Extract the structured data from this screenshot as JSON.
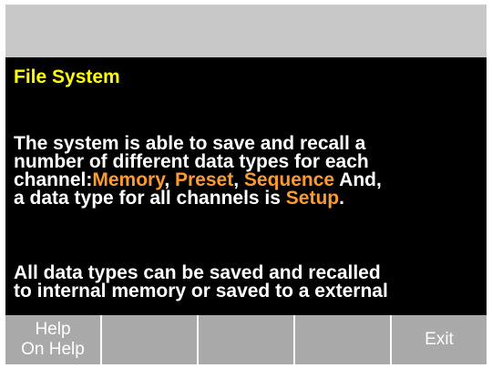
{
  "title": "File System",
  "paragraph1": {
    "lead": "The system is able to save and recall a\nnumber of different data types for each\nchannel:",
    "term_memory": "Memory",
    "sep1": ", ",
    "term_preset": "Preset",
    "sep2": ", ",
    "term_sequence": "Sequence",
    "mid": " And,\na data type for all channels is ",
    "term_setup": "Setup",
    "end": "."
  },
  "paragraph2": "All data types can be saved and recalled\nto internal memory or saved to a external",
  "softkeys": {
    "help_line1": "Help",
    "help_line2": "On Help",
    "key2": "",
    "key3": "",
    "key4": "",
    "exit": "Exit"
  },
  "colors": {
    "panel_background": "#000000",
    "title": "#ffff00",
    "body_text": "#ffffff",
    "highlight_term": "#ff9a2e",
    "top_bar": "#c8c8c8",
    "softkey": "#a9a9a9"
  }
}
